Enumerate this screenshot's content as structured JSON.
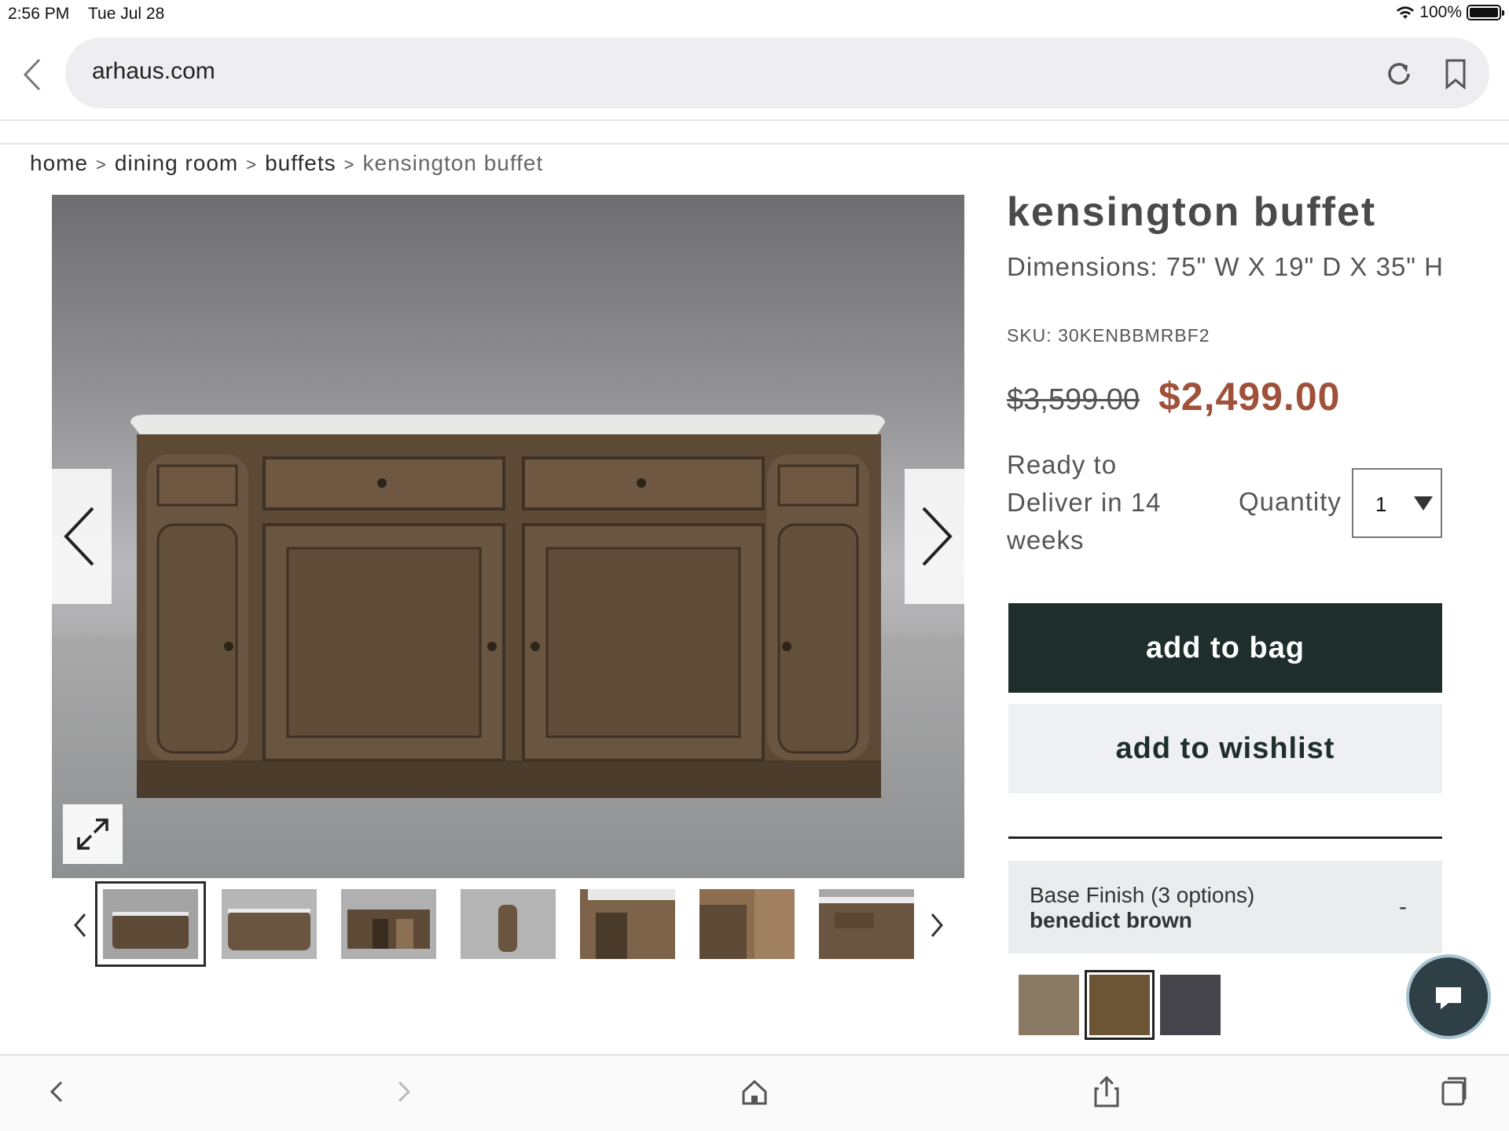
{
  "status_bar": {
    "time": "2:56 PM",
    "date": "Tue Jul 28",
    "battery": "100%"
  },
  "browser": {
    "url": "arhaus.com"
  },
  "breadcrumb": {
    "home": "home",
    "dining_room": "dining room",
    "buffets": "buffets",
    "current": "kensington buffet",
    "separator": ">"
  },
  "product": {
    "title": "kensington buffet",
    "dimensions": "Dimensions: 75\" W X 19\" D X 35\" H",
    "sku": "SKU: 30KENBBMRBF2",
    "original_price": "$3,599.00",
    "sale_price": "$2,499.00",
    "delivery": "Ready to Deliver in 14 weeks",
    "quantity_label": "Quantity",
    "quantity_value": "1",
    "add_to_bag": "add to bag",
    "add_to_wishlist": "add to wishlist"
  },
  "finish": {
    "label": "Base Finish (3 options)",
    "value": "benedict brown",
    "toggle": "-"
  },
  "swatches": [
    {
      "name": "light wood",
      "color": "#8a7a63"
    },
    {
      "name": "benedict brown",
      "color": "#6b5535"
    },
    {
      "name": "dark",
      "color": "#44444a"
    }
  ],
  "colors": {
    "accent": "#1e2e2b",
    "sale": "#a0513a"
  },
  "icons": [
    "back-icon",
    "reload-icon",
    "bookmark-icon",
    "chevron-left-icon",
    "chevron-right-icon",
    "expand-icon",
    "chat-icon",
    "home-icon",
    "share-icon",
    "tabs-icon"
  ]
}
